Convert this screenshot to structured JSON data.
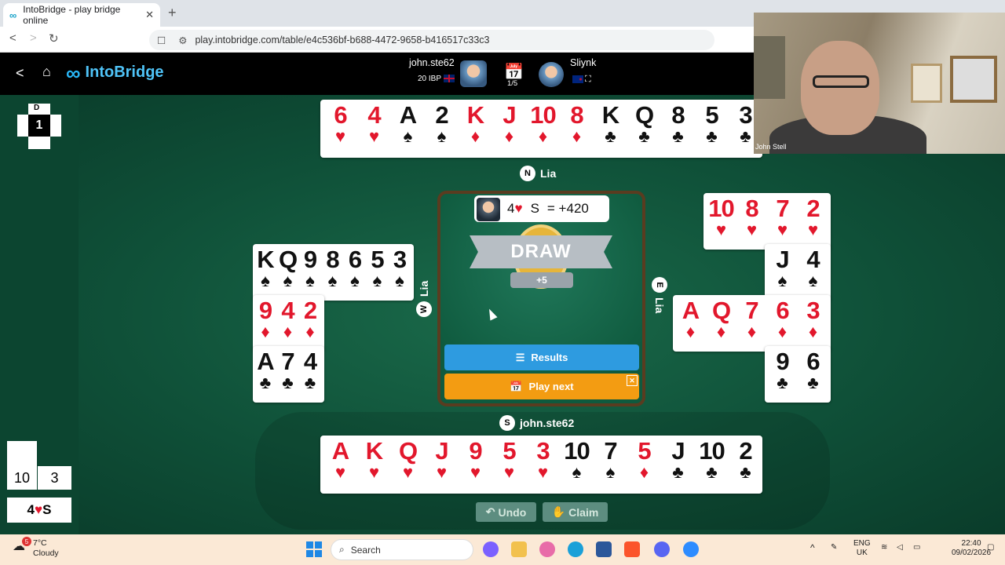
{
  "browser": {
    "tab_title": "IntoBridge - play bridge online",
    "url": "play.intobridge.com/table/e4c536bf-b688-4472-9658-b416517c33c3"
  },
  "app": {
    "logo_text": "IntoBridge",
    "player1": {
      "name": "john.ste62",
      "ibp": "20 IBP"
    },
    "board_counter": "1/5",
    "player2": {
      "name": "Sliynk"
    }
  },
  "board": {
    "dealer": "D",
    "number": "1"
  },
  "north": {
    "seat": "N",
    "name": "Lia",
    "cards": [
      {
        "r": "6",
        "s": "♥",
        "c": "red"
      },
      {
        "r": "4",
        "s": "♥",
        "c": "red"
      },
      {
        "r": "A",
        "s": "♠",
        "c": "blk"
      },
      {
        "r": "2",
        "s": "♠",
        "c": "blk"
      },
      {
        "r": "K",
        "s": "♦",
        "c": "red"
      },
      {
        "r": "J",
        "s": "♦",
        "c": "red"
      },
      {
        "r": "10",
        "s": "♦",
        "c": "red"
      },
      {
        "r": "8",
        "s": "♦",
        "c": "red"
      },
      {
        "r": "K",
        "s": "♣",
        "c": "blk"
      },
      {
        "r": "Q",
        "s": "♣",
        "c": "blk"
      },
      {
        "r": "8",
        "s": "♣",
        "c": "blk"
      },
      {
        "r": "5",
        "s": "♣",
        "c": "blk"
      },
      {
        "r": "3",
        "s": "♣",
        "c": "blk"
      }
    ]
  },
  "west": {
    "seat": "W",
    "name": "Lia",
    "rows": [
      [
        {
          "r": "K",
          "s": "♠",
          "c": "blk"
        },
        {
          "r": "Q",
          "s": "♠",
          "c": "blk"
        },
        {
          "r": "9",
          "s": "♠",
          "c": "blk"
        },
        {
          "r": "8",
          "s": "♠",
          "c": "blk"
        },
        {
          "r": "6",
          "s": "♠",
          "c": "blk"
        },
        {
          "r": "5",
          "s": "♠",
          "c": "blk"
        },
        {
          "r": "3",
          "s": "♠",
          "c": "blk"
        }
      ],
      [
        {
          "r": "9",
          "s": "♦",
          "c": "red"
        },
        {
          "r": "4",
          "s": "♦",
          "c": "red"
        },
        {
          "r": "2",
          "s": "♦",
          "c": "red"
        }
      ],
      [
        {
          "r": "A",
          "s": "♣",
          "c": "blk"
        },
        {
          "r": "7",
          "s": "♣",
          "c": "blk"
        },
        {
          "r": "4",
          "s": "♣",
          "c": "blk"
        }
      ]
    ]
  },
  "east": {
    "seat": "E",
    "name": "Lia",
    "rows": [
      [
        {
          "r": "10",
          "s": "♥",
          "c": "red"
        },
        {
          "r": "8",
          "s": "♥",
          "c": "red"
        },
        {
          "r": "7",
          "s": "♥",
          "c": "red"
        },
        {
          "r": "2",
          "s": "♥",
          "c": "red"
        }
      ],
      [
        {
          "r": "J",
          "s": "♠",
          "c": "blk"
        },
        {
          "r": "4",
          "s": "♠",
          "c": "blk"
        }
      ],
      [
        {
          "r": "A",
          "s": "♦",
          "c": "red"
        },
        {
          "r": "Q",
          "s": "♦",
          "c": "red"
        },
        {
          "r": "7",
          "s": "♦",
          "c": "red"
        },
        {
          "r": "6",
          "s": "♦",
          "c": "red"
        },
        {
          "r": "3",
          "s": "♦",
          "c": "red"
        }
      ],
      [
        {
          "r": "9",
          "s": "♣",
          "c": "blk"
        },
        {
          "r": "6",
          "s": "♣",
          "c": "blk"
        }
      ]
    ]
  },
  "south": {
    "seat": "S",
    "name": "john.ste62",
    "cards": [
      {
        "r": "A",
        "s": "♥",
        "c": "red"
      },
      {
        "r": "K",
        "s": "♥",
        "c": "red"
      },
      {
        "r": "Q",
        "s": "♥",
        "c": "red"
      },
      {
        "r": "J",
        "s": "♥",
        "c": "red"
      },
      {
        "r": "9",
        "s": "♥",
        "c": "red"
      },
      {
        "r": "5",
        "s": "♥",
        "c": "red"
      },
      {
        "r": "3",
        "s": "♥",
        "c": "red"
      },
      {
        "r": "10",
        "s": "♠",
        "c": "blk"
      },
      {
        "r": "7",
        "s": "♠",
        "c": "blk"
      },
      {
        "r": "5",
        "s": "♦",
        "c": "red"
      },
      {
        "r": "J",
        "s": "♣",
        "c": "blk"
      },
      {
        "r": "10",
        "s": "♣",
        "c": "blk"
      },
      {
        "r": "2",
        "s": "♣",
        "c": "blk"
      }
    ]
  },
  "result": {
    "contract_level": "4",
    "contract_suit": "♥",
    "declarer": "S",
    "score": "= +420",
    "outcome": "DRAW",
    "points": "+5"
  },
  "buttons": {
    "results": "Results",
    "play_next": "Play next",
    "undo": "Undo",
    "claim": "Claim"
  },
  "tricks": {
    "ns": "10",
    "ew": "3"
  },
  "contract_box": {
    "level": "4",
    "suit": "♥",
    "declarer": "S"
  },
  "webcam": {
    "name": "John Stell"
  },
  "taskbar": {
    "temp": "7°C",
    "weather": "Cloudy",
    "weather_badge": "5",
    "search": "Search",
    "lang1": "ENG",
    "lang2": "UK",
    "time": "22:40",
    "date": "09/02/2026"
  }
}
